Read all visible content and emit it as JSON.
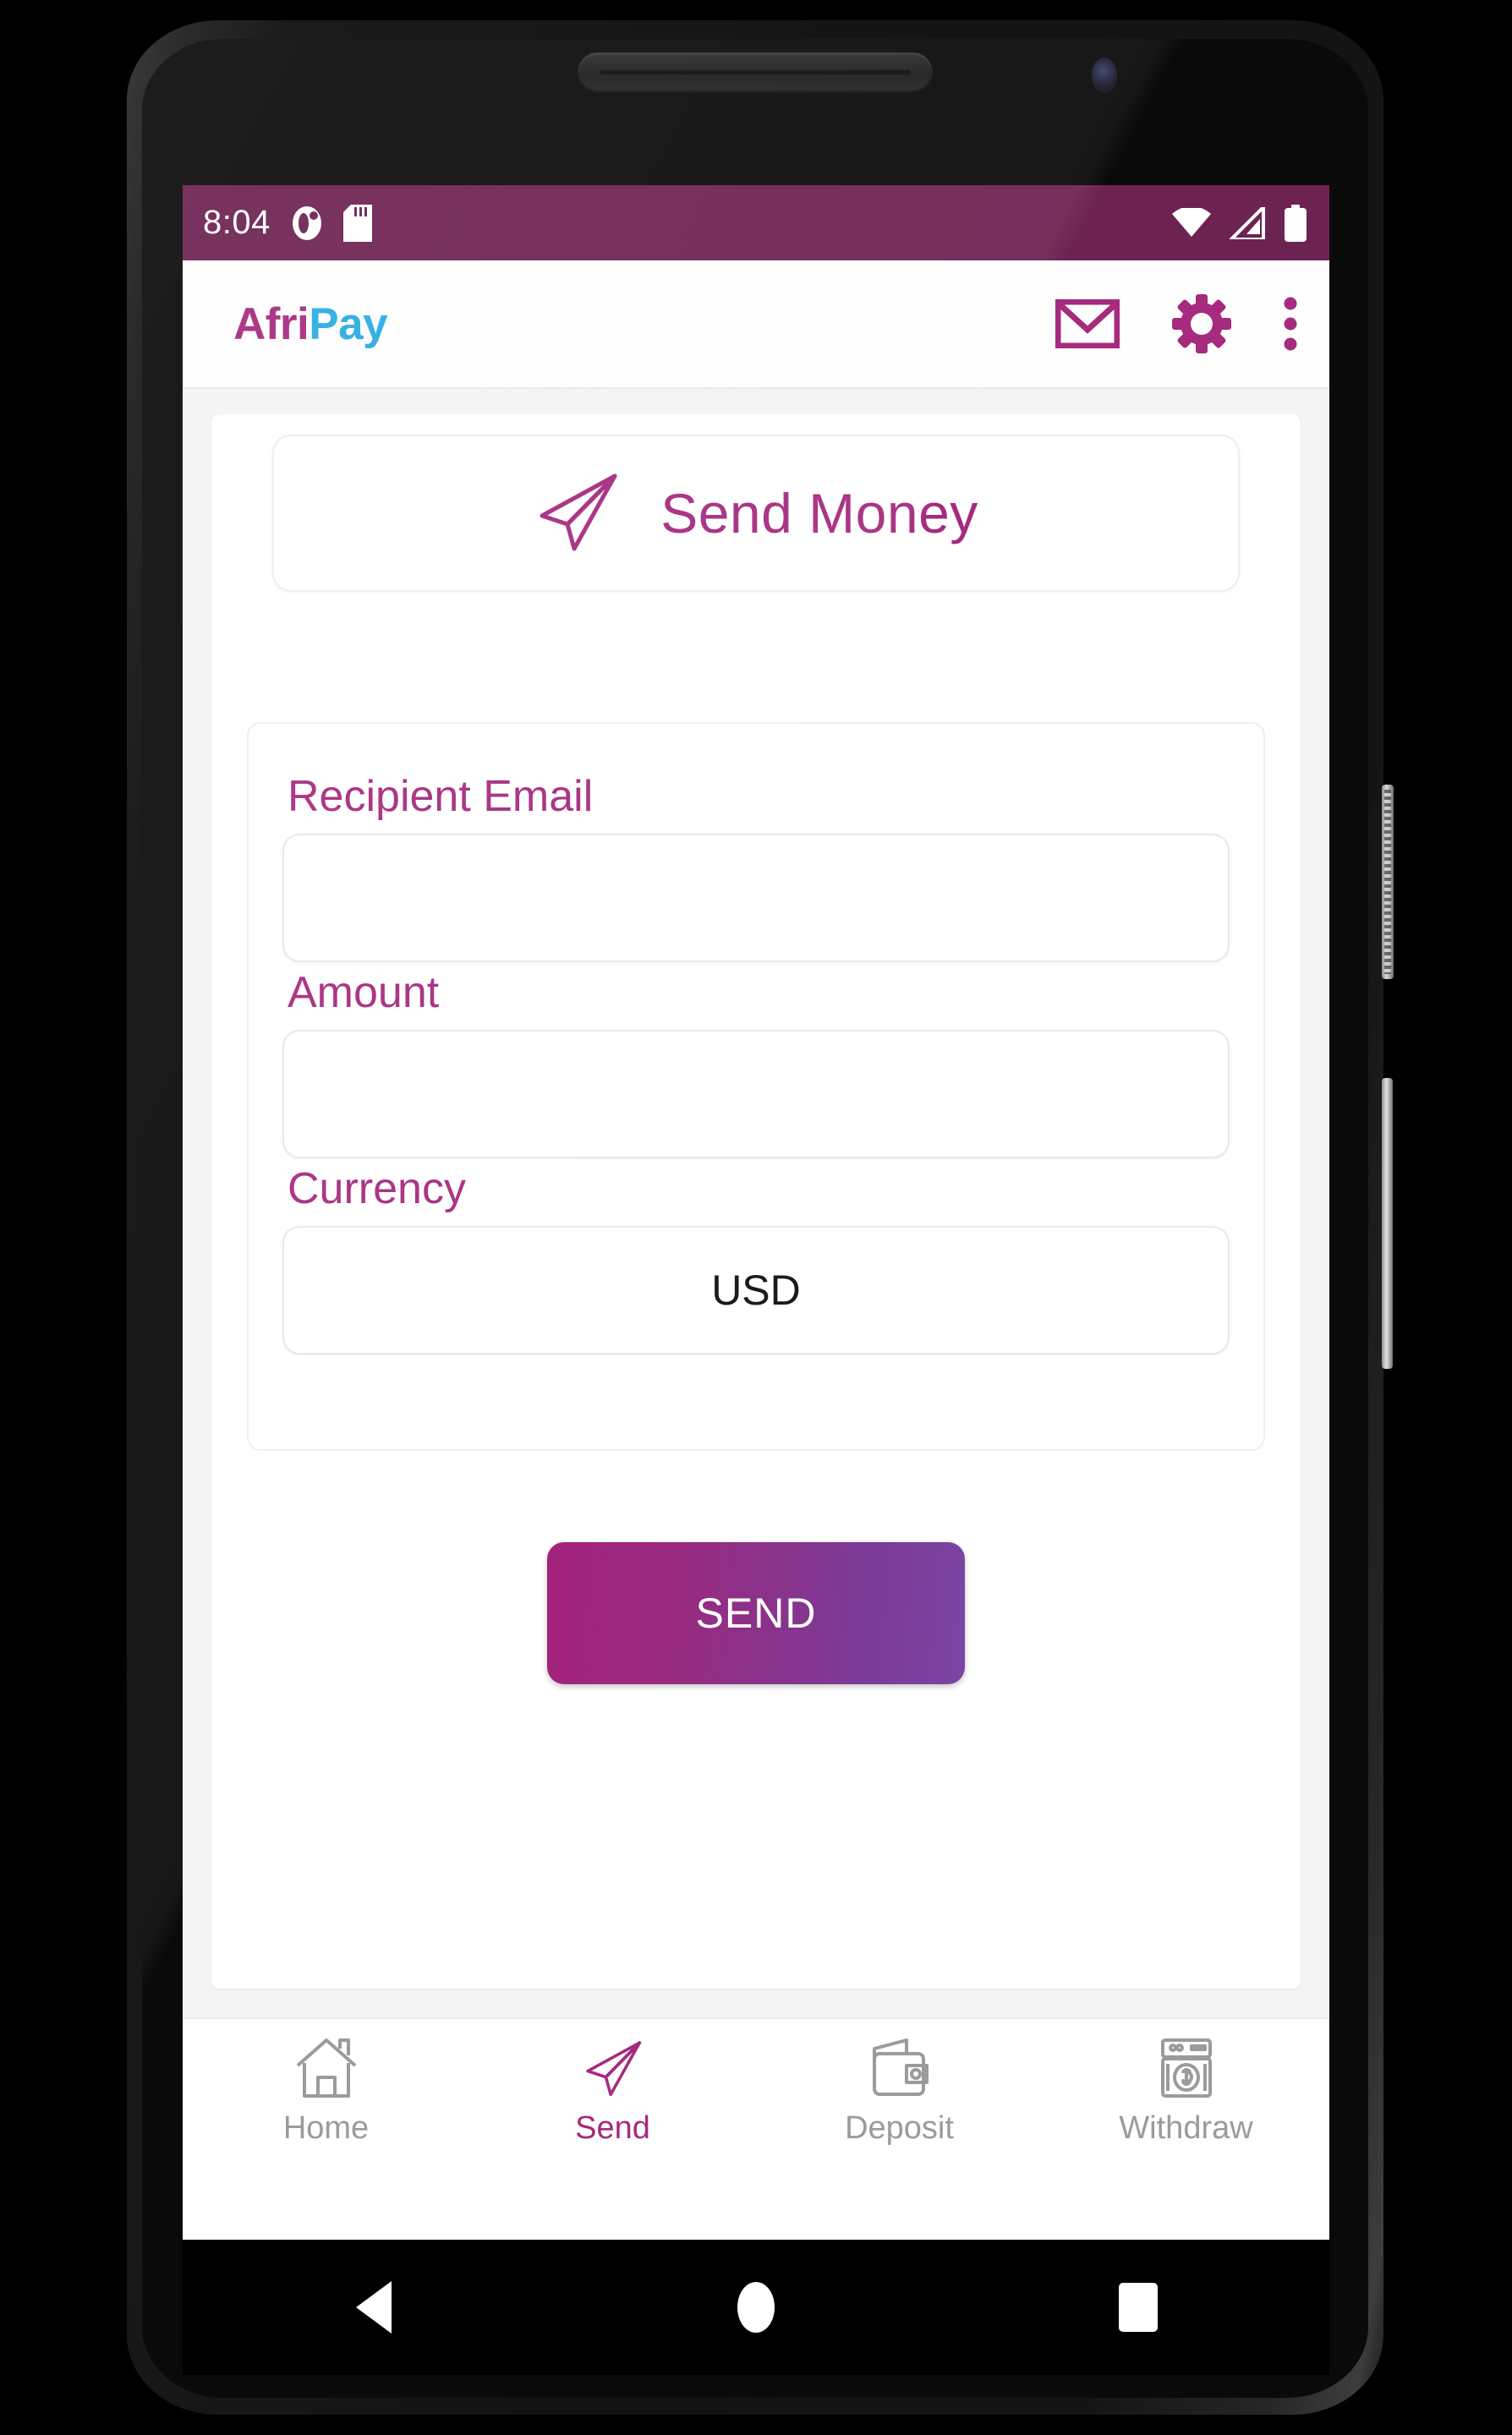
{
  "status_bar": {
    "time": "8:04",
    "icons_left": [
      "profile-badge-icon",
      "sd-card-icon"
    ],
    "icons_right": [
      "wifi-icon",
      "cellular-signal-icon",
      "battery-icon"
    ],
    "background_color": "#6d2352"
  },
  "app_bar": {
    "brand_first": "Afri",
    "brand_second": "Pay",
    "brand_first_color": "#a62a7e",
    "brand_second_color": "#29abe2",
    "actions": [
      {
        "name": "mail-icon",
        "label": "Messages"
      },
      {
        "name": "gear-icon",
        "label": "Settings"
      },
      {
        "name": "overflow-menu-icon",
        "label": "More options"
      }
    ]
  },
  "header": {
    "icon": "paper-plane-icon",
    "title": "Send Money"
  },
  "form": {
    "fields": [
      {
        "id": "recipient-email",
        "label": "Recipient Email",
        "type": "text",
        "value": "",
        "placeholder": ""
      },
      {
        "id": "amount",
        "label": "Amount",
        "type": "text",
        "value": "",
        "placeholder": ""
      },
      {
        "id": "currency",
        "label": "Currency",
        "type": "select",
        "value": "USD"
      }
    ]
  },
  "actions": {
    "send_label": "SEND",
    "send_gradient_from": "#a3227c",
    "send_gradient_to": "#7c45a4"
  },
  "bottom_nav": {
    "active": "Send",
    "items": [
      {
        "icon": "home-icon",
        "label": "Home"
      },
      {
        "icon": "paper-plane-icon",
        "label": "Send"
      },
      {
        "icon": "wallet-icon",
        "label": "Deposit"
      },
      {
        "icon": "cash-atm-icon",
        "label": "Withdraw"
      }
    ]
  },
  "system_nav": {
    "buttons": [
      {
        "icon": "back-triangle-icon",
        "label": "Back"
      },
      {
        "icon": "home-circle-icon",
        "label": "Home"
      },
      {
        "icon": "recents-square-icon",
        "label": "Recents"
      }
    ]
  },
  "theme": {
    "accent": "#a62a7e",
    "accent_dark": "#6d2352",
    "secondary": "#29abe2",
    "muted": "#9b9b9b"
  }
}
